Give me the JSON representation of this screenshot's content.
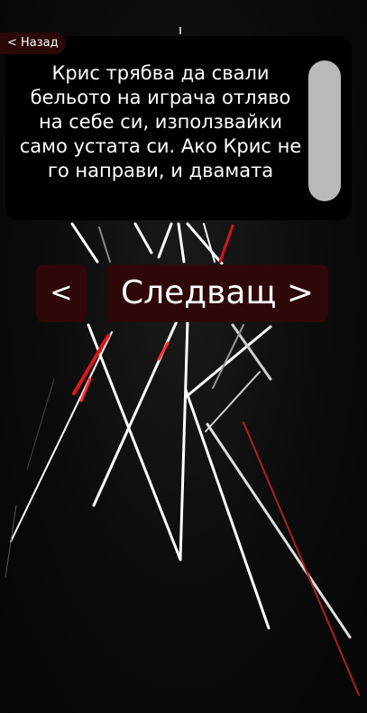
{
  "header": {
    "back_label": "< Назад"
  },
  "task": {
    "text": "Крис трябва да свали бельото на играча отляво на себе си, използвайки само устата си. Ако Крис не го направи, и двамата"
  },
  "navigation": {
    "prev_label": "<",
    "next_label": "Следващ >"
  },
  "colors": {
    "accent_red": "#d01818",
    "button_bg": "#2e0808",
    "line_white": "#ffffff"
  }
}
